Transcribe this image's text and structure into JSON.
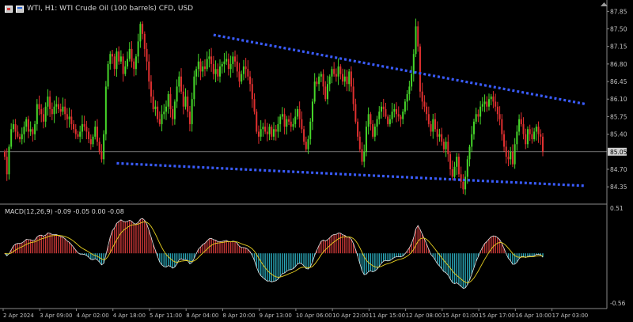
{
  "header": {
    "title": "WTI, H1:  WTI Crude Oil (100 barrels) CFD, USD",
    "icons": [
      "chart-type-icon",
      "symbol-icon"
    ]
  },
  "indicator": {
    "label": "MACD(12,26,9) -0.09 -0.05 0.00 -0.08"
  },
  "colors": {
    "background": "#000000",
    "bull": "#46d62a",
    "bear": "#e03030",
    "trendline": "#3a5cff",
    "hist_positive": "#c93838",
    "hist_negative": "#2aa7b8",
    "macd_line": "#e0e0e0",
    "signal_line": "#e8d020",
    "grid_text": "#c0c0c0"
  },
  "chart_data": [
    {
      "type": "candlestick",
      "symbol": "WTI",
      "timeframe": "H1",
      "y_ticks": [
        "87.85",
        "87.50",
        "87.15",
        "86.80",
        "86.45",
        "86.10",
        "85.75",
        "85.40",
        "84.70",
        "84.35"
      ],
      "ylim": [
        84.1,
        87.95
      ],
      "current_price": 85.05,
      "current_price_label": "85.05",
      "x_ticks": [
        "2 Apr 2024",
        "3 Apr 09:00",
        "4 Apr 02:00",
        "4 Apr 18:00",
        "5 Apr 11:00",
        "8 Apr 04:00",
        "8 Apr 20:00",
        "9 Apr 13:00",
        "10 Apr 06:00",
        "10 Apr 22:00",
        "11 Apr 15:00",
        "12 Apr 08:00",
        "15 Apr 01:00",
        "15 Apr 17:00",
        "16 Apr 10:00",
        "17 Apr 03:00"
      ],
      "x_tick_index": [
        0,
        17,
        34,
        51,
        68,
        85,
        102,
        119,
        136,
        153,
        170,
        187,
        204,
        221,
        238,
        255
      ],
      "close": [
        84.95,
        84.6,
        85.15,
        85.5,
        85.6,
        85.45,
        85.35,
        85.3,
        85.4,
        85.55,
        85.7,
        85.45,
        85.5,
        85.4,
        85.6,
        86.0,
        85.9,
        85.8,
        85.65,
        85.95,
        86.15,
        85.9,
        85.8,
        85.95,
        86.0,
        85.9,
        85.85,
        85.95,
        85.8,
        85.7,
        85.75,
        85.6,
        85.5,
        85.4,
        85.35,
        85.45,
        85.6,
        85.55,
        85.45,
        85.3,
        85.2,
        85.35,
        85.55,
        85.25,
        85.05,
        84.9,
        85.4,
        86.35,
        86.8,
        87.0,
        86.95,
        86.7,
        87.05,
        86.85,
        86.95,
        86.6,
        86.75,
        86.9,
        87.1,
        86.85,
        86.7,
        86.95,
        87.25,
        87.6,
        87.4,
        87.1,
        86.85,
        86.45,
        86.15,
        85.9,
        85.95,
        85.7,
        85.6,
        85.8,
        85.85,
        85.95,
        86.2,
        85.9,
        85.7,
        86.05,
        86.35,
        86.55,
        86.25,
        85.95,
        86.15,
        85.85,
        85.6,
        86.1,
        86.55,
        86.7,
        86.85,
        86.65,
        86.75,
        86.7,
        86.9,
        86.95,
        86.8,
        86.6,
        86.7,
        86.55,
        86.75,
        86.8,
        86.85,
        86.9,
        86.7,
        86.8,
        86.95,
        86.85,
        86.65,
        86.45,
        86.6,
        86.75,
        86.7,
        86.55,
        86.4,
        86.1,
        85.85,
        85.45,
        85.35,
        85.5,
        85.55,
        85.45,
        85.4,
        85.55,
        85.35,
        85.5,
        85.45,
        85.6,
        85.75,
        85.8,
        85.55,
        85.7,
        85.65,
        85.55,
        85.6,
        85.75,
        85.9,
        85.7,
        85.5,
        85.25,
        85.1,
        85.3,
        85.65,
        86.05,
        86.45,
        86.4,
        86.55,
        86.6,
        86.35,
        86.1,
        86.4,
        86.55,
        86.7,
        86.6,
        86.55,
        86.75,
        86.6,
        86.45,
        86.55,
        86.4,
        86.65,
        86.35,
        86.0,
        85.65,
        85.35,
        85.1,
        84.85,
        85.05,
        85.55,
        85.8,
        85.6,
        85.35,
        85.55,
        85.7,
        85.85,
        85.95,
        85.9,
        85.75,
        85.6,
        85.7,
        85.85,
        85.9,
        85.8,
        85.75,
        85.7,
        85.85,
        86.05,
        86.2,
        86.35,
        86.6,
        87.0,
        87.55,
        87.15,
        86.25,
        86.05,
        85.95,
        85.8,
        85.6,
        85.45,
        85.7,
        85.5,
        85.35,
        85.4,
        85.25,
        85.1,
        85.25,
        85.0,
        84.7,
        84.55,
        84.75,
        84.95,
        84.6,
        84.45,
        84.3,
        84.55,
        84.9,
        85.15,
        85.4,
        85.65,
        85.8,
        85.75,
        85.95,
        86.0,
        86.05,
        85.95,
        86.1,
        86.15,
        86.05,
        85.95,
        85.8,
        85.7,
        85.4,
        85.15,
        84.95,
        84.9,
        85.05,
        84.8,
        85.2,
        85.45,
        85.7,
        85.6,
        85.4,
        85.2,
        85.5,
        85.4,
        85.3,
        85.45,
        85.55,
        85.4,
        85.35,
        85.05
      ]
    },
    {
      "type": "macd",
      "label": "MACD(12,26,9)",
      "fast": 12,
      "slow": 26,
      "signal": 9,
      "values": [
        -0.09,
        -0.05,
        0.0,
        -0.08
      ],
      "y_ticks": [
        "0.51",
        "-0.56"
      ],
      "ylim": [
        -0.56,
        0.51
      ]
    }
  ]
}
